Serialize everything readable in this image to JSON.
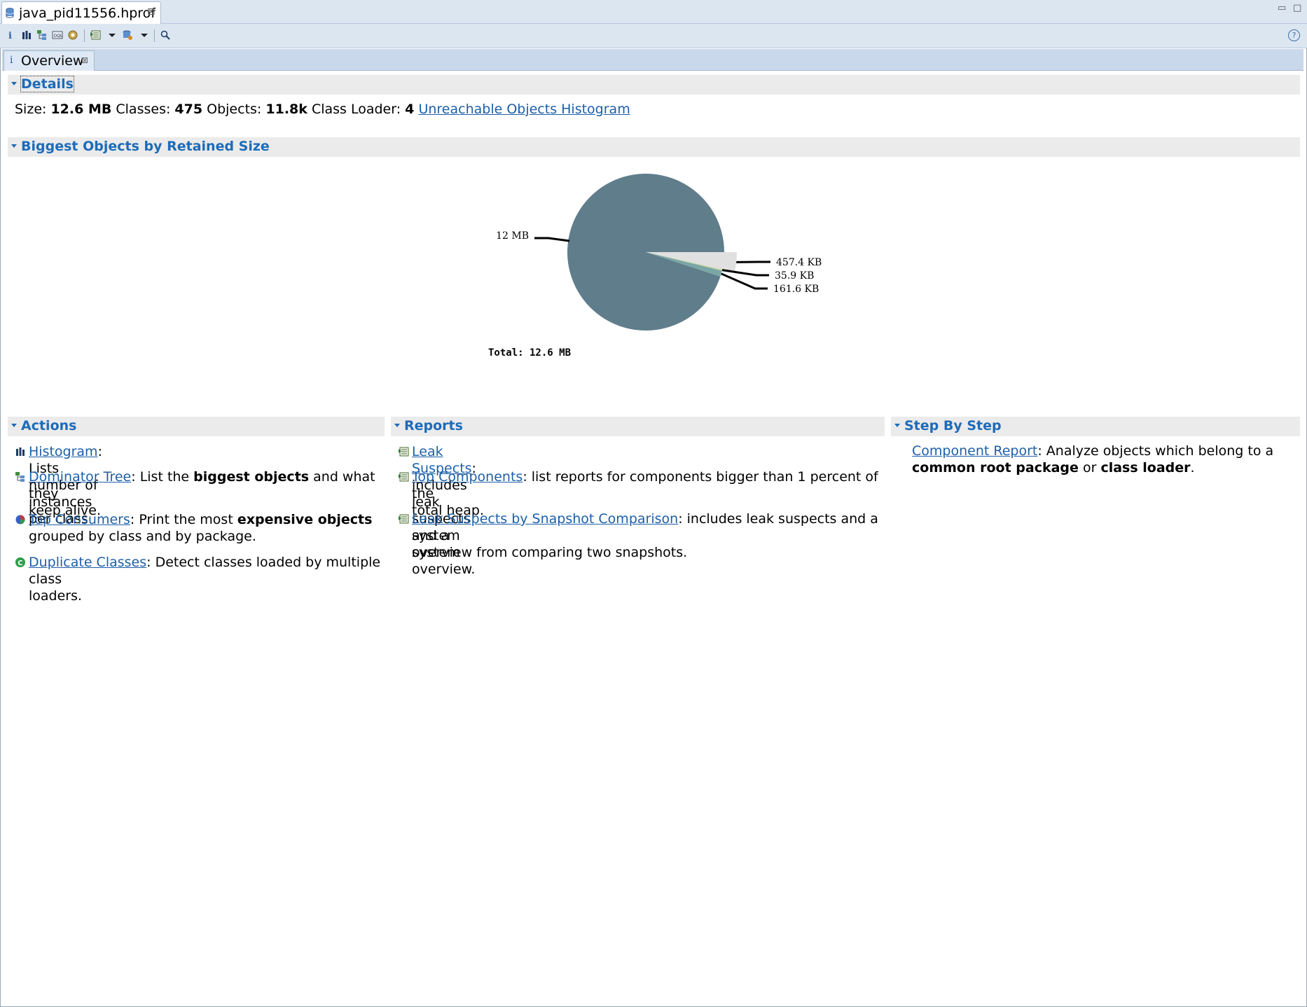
{
  "editor_tab": {
    "title": "java_pid11556.hprof",
    "close": "⊠"
  },
  "window_controls": {
    "minimize": "▭",
    "maximize": "□"
  },
  "toolbar": {
    "items": [
      "info-icon",
      "histogram-icon",
      "dominator-tree-icon",
      "oql-icon",
      "thread-overview-icon",
      "run-report-icon",
      "dropdown-arrow-icon",
      "query-browser-icon",
      "dropdown-arrow-icon",
      "search-icon"
    ],
    "help": "?"
  },
  "overview_tab": {
    "icon": "i",
    "label": "Overview",
    "close": "⊠"
  },
  "details": {
    "header": "Details",
    "size_label": "Size:",
    "size_value": "12.6 MB",
    "classes_label": "Classes:",
    "classes_value": "475",
    "objects_label": "Objects:",
    "objects_value": "11.8k",
    "classloader_label": "Class Loader:",
    "classloader_value": "4",
    "unreachable_link": "Unreachable Objects Histogram"
  },
  "biggest": {
    "header": "Biggest Objects by Retained Size"
  },
  "chart_data": {
    "type": "pie",
    "slices": [
      {
        "label": "12 MB",
        "value": 12.0,
        "unit": "MB",
        "color": "#607d8b"
      },
      {
        "label": "457.4 KB",
        "value": 457.4,
        "unit": "KB",
        "color": "#e0e0e0"
      },
      {
        "label": "35.9 KB",
        "value": 35.9,
        "unit": "KB",
        "color": "#c8d6a0"
      },
      {
        "label": "161.6 KB",
        "value": 161.6,
        "unit": "KB",
        "color": "#7aa6a6"
      }
    ],
    "total_label": "Total: 12.6 MB"
  },
  "actions": {
    "header": "Actions",
    "items": [
      {
        "link": "Histogram",
        "text": ": Lists number of instances per class"
      },
      {
        "link": "Dominator Tree",
        "text_a": ": List the ",
        "bold": "biggest objects",
        "text_b": " and what they",
        "text_c": "keep alive."
      },
      {
        "link": "Top Consumers",
        "text_a": ": Print the most ",
        "bold": "expensive objects",
        "text_c": "grouped by class and by package."
      },
      {
        "link": "Duplicate Classes",
        "text_a": ": Detect classes loaded by multiple class",
        "text_c": "loaders."
      }
    ]
  },
  "reports": {
    "header": "Reports",
    "items": [
      {
        "link": "Leak Suspects",
        "text": ": includes leak suspects and a system overview."
      },
      {
        "link": "Top Components",
        "text": ": list reports for components bigger than 1 percent of the",
        "text_c": "total heap."
      },
      {
        "link": "Leak Suspects by Snapshot Comparison",
        "text": ": includes leak suspects and a system",
        "text_c": "overview from comparing two snapshots."
      }
    ]
  },
  "stepbystep": {
    "header": "Step By Step",
    "link": "Component Report",
    "text_a": ": Analyze objects which belong to a",
    "bold_a": "common root package",
    "text_b": " or ",
    "bold_b": "class loader",
    "text_c": "."
  }
}
